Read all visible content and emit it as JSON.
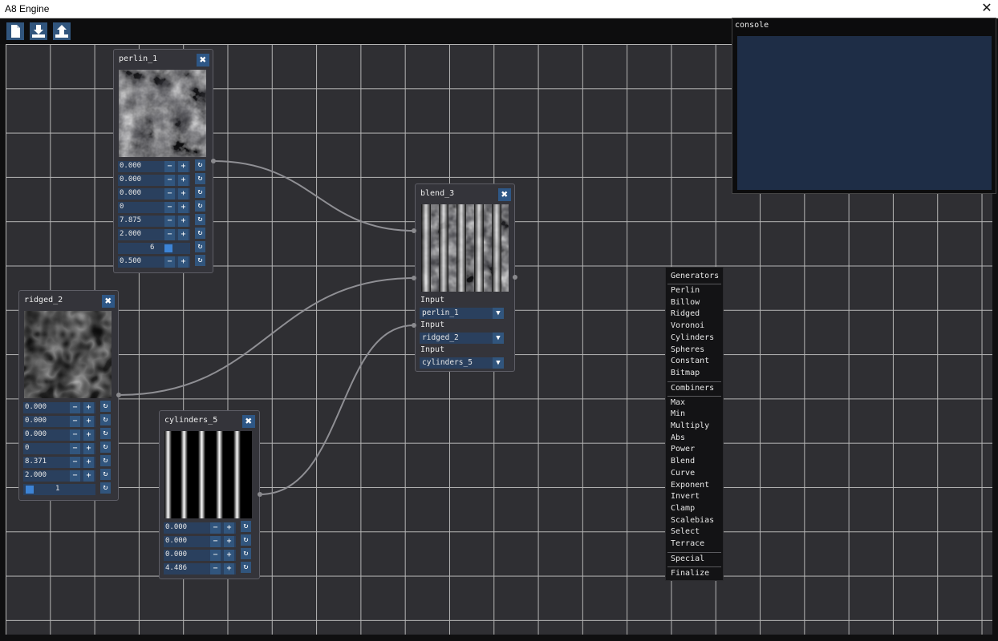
{
  "window": {
    "title": "A8 Engine",
    "close_glyph": "✕"
  },
  "toolbar": {
    "buttons": [
      {
        "icon": "new-file-icon"
      },
      {
        "icon": "import-icon"
      },
      {
        "icon": "export-icon"
      }
    ]
  },
  "console": {
    "title": "console"
  },
  "nodes": {
    "perlin": {
      "title": "perlin_1",
      "values": [
        "0.000",
        "0.000",
        "0.000",
        "0",
        "7.875",
        "2.000"
      ],
      "slider_value": "6",
      "last_value": "0.500"
    },
    "ridged": {
      "title": "ridged_2",
      "values": [
        "0.000",
        "0.000",
        "0.000",
        "0",
        "8.371",
        "2.000"
      ],
      "slider_value": "1"
    },
    "cylinders": {
      "title": "cylinders_5",
      "values": [
        "0.000",
        "0.000",
        "0.000",
        "4.486"
      ]
    },
    "blend": {
      "title": "blend_3",
      "input_label": "Input",
      "inputs": [
        "perlin_1",
        "ridged_2",
        "cylinders_5"
      ]
    }
  },
  "controls": {
    "minus": "−",
    "plus": "+",
    "reset": "↻",
    "dropdown": "▼",
    "close": "✖"
  },
  "menu": {
    "sections": [
      {
        "header": "Generators",
        "items": [
          "Perlin",
          "Billow",
          "Ridged",
          "Voronoi",
          "Cylinders",
          "Spheres",
          "Constant",
          "Bitmap"
        ]
      },
      {
        "header": "Combiners",
        "items": [
          "Max",
          "Min",
          "Multiply",
          "Abs",
          "Power",
          "Blend",
          "Curve",
          "Exponent",
          "Invert",
          "Clamp",
          "Scalebias",
          "Select",
          "Terrace"
        ]
      },
      {
        "header": "Special",
        "items": []
      },
      {
        "header": "Finalize",
        "items": []
      }
    ]
  },
  "colors": {
    "canvas": "#2f2f33",
    "grid": "#b5b5b5",
    "node": "#34343a",
    "field": "#2a405e",
    "button": "#31557d",
    "accent": "#3d84d6",
    "console_body": "#1e2d46"
  }
}
